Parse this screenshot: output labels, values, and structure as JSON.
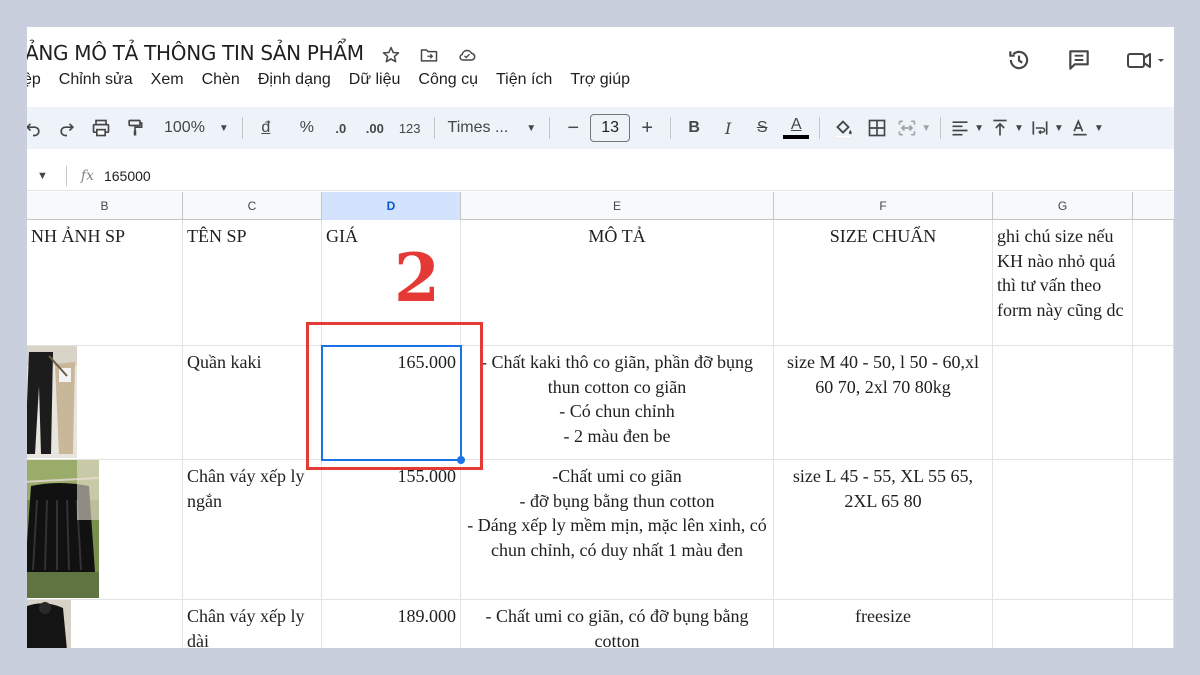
{
  "doc": {
    "title": "ẢNG MÔ TẢ THÔNG TIN SẢN PHẨM"
  },
  "menu": [
    "ệp",
    "Chỉnh sửa",
    "Xem",
    "Chèn",
    "Định dạng",
    "Dữ liệu",
    "Công cụ",
    "Tiện ích",
    "Trợ giúp"
  ],
  "toolbar": {
    "zoom": "100%",
    "currency": "đ",
    "percent": "%",
    "dec_decrease": ".0",
    "dec_increase": ".00",
    "format_123": "123",
    "font": "Times ...",
    "font_size": "13",
    "minus": "−",
    "plus": "+",
    "bold": "B",
    "italic": "I",
    "strike": "S",
    "text_color": "A",
    "font_color_swatch": "#000000"
  },
  "formula": {
    "fx": "fx",
    "value": "165000"
  },
  "columns": [
    "B",
    "C",
    "D",
    "E",
    "F",
    "G"
  ],
  "selected_column": "D",
  "header_row": {
    "b": "NH ẢNH SP",
    "c": "TÊN SP",
    "d": "GIÁ",
    "e": "MÔ TẢ",
    "f": "SIZE CHUẨN",
    "g": "ghi chú size nếu KH nào nhỏ quá thì tư vấn theo form này cũng dc"
  },
  "rows": [
    {
      "name": "Quần kaki",
      "price": "165.000",
      "desc": "- Chất kaki thô co giãn, phần đỡ bụng thun cotton co giãn\n- Có chun chỉnh\n- 2 màu đen be",
      "size": "size M 40 - 50, l 50 - 60,xl 60 70, 2xl 70 80kg"
    },
    {
      "name": "Chân váy xếp ly ngắn",
      "price": "155.000",
      "desc": "-Chất umi co giãn\n- đỡ bụng bằng thun cotton\n- Dáng xếp ly mềm mịn, mặc lên xinh, có chun chỉnh, có duy nhất 1 màu đen",
      "size": "size L 45 - 55, XL 55 65, 2XL 65 80"
    },
    {
      "name": "Chân váy xếp ly dài",
      "price": "189.000",
      "desc": "- Chất umi co giãn, có đỡ bụng bằng cotton",
      "size": "freesize"
    }
  ],
  "annotation": {
    "step": "2",
    "color": "#e53935"
  },
  "colors": {
    "selection": "#1a73e8",
    "toolbar_bg": "#eef2f9",
    "page_bg": "#c9cfdc"
  }
}
